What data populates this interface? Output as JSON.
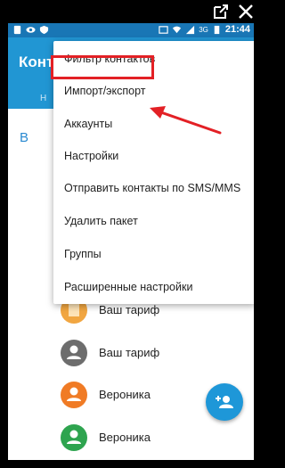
{
  "statusbar": {
    "time": "21:44",
    "network": "3G"
  },
  "appbar": {
    "title": "Контакты",
    "tab_hint": "Н"
  },
  "section_letter": "В",
  "menu": {
    "items": [
      {
        "label": "Фильтр контактов"
      },
      {
        "label": "Импорт/экспорт"
      },
      {
        "label": "Аккаунты"
      },
      {
        "label": "Настройки"
      },
      {
        "label": "Отправить контакты по SMS/MMS"
      },
      {
        "label": "Удалить пакет"
      },
      {
        "label": "Группы"
      },
      {
        "label": "Расширенные настройки"
      }
    ]
  },
  "contacts": [
    {
      "name": "Ваш тариф",
      "avatar_color": "#f1a641",
      "avatar_icon": "building-icon"
    },
    {
      "name": "Ваш тариф",
      "avatar_color": "#6d6d6d",
      "avatar_icon": "person-icon"
    },
    {
      "name": "Вероника",
      "avatar_color": "#f07b25",
      "avatar_icon": "person-icon"
    },
    {
      "name": "Вероника",
      "avatar_color": "#2ea44f",
      "avatar_icon": "person-icon"
    }
  ],
  "colors": {
    "primary": "#2196d3",
    "statusbar": "#1976b5",
    "accent": "#1e97d8",
    "annotation": "#e32025"
  }
}
